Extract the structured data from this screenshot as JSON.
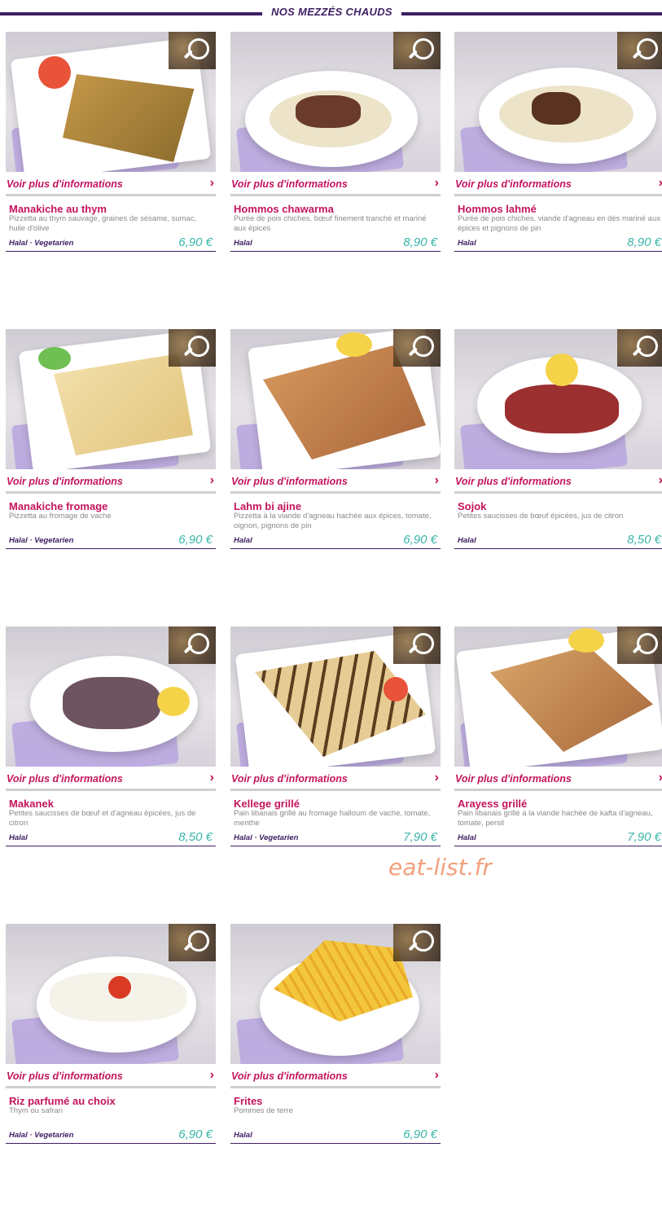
{
  "section_title": "NOS MEZZÉS CHAUDS",
  "more_label": "Voir plus d'informations",
  "watermark": "eat-list.fr",
  "colors": {
    "brand": "#3d1f63",
    "accent": "#c4145c",
    "price": "#39b5a9"
  },
  "items": [
    {
      "name": "Manakiche au thym",
      "desc": "Pizzetta au thym sauvage, graines de sésame, sumac, huile d'olive",
      "tags": "Halal · Vegetarien",
      "price": "6,90 €"
    },
    {
      "name": "Hommos chawarma",
      "desc": "Purée de pois chiches, bœuf finement tranché et mariné aux épices",
      "tags": "Halal",
      "price": "8,90 €"
    },
    {
      "name": "Hommos lahmé",
      "desc": "Purée de pois chiches, viande d'agneau en dés mariné aux épices et pignons de pin",
      "tags": "Halal",
      "price": "8,90 €"
    },
    {
      "name": "Manakiche fromage",
      "desc": "Pizzetta au fromage de vache",
      "tags": "Halal · Vegetarien",
      "price": "6,90 €"
    },
    {
      "name": "Lahm bi ajine",
      "desc": "Pizzetta à la viande d'agneau hachée aux épices, tomate, oignon, pignons de pin",
      "tags": "Halal",
      "price": "6,90 €"
    },
    {
      "name": "Sojok",
      "desc": "Petites saucisses de bœuf épicées, jus de citron",
      "tags": "Halal",
      "price": "8,50 €"
    },
    {
      "name": "Makanek",
      "desc": "Petites saucisses de bœuf et d'agneau épicées, jus de citron",
      "tags": "Halal",
      "price": "8,50 €"
    },
    {
      "name": "Kellege grillé",
      "desc": "Pain libanais grillé au fromage halloum de vache, tomate, menthe",
      "tags": "Halal · Vegetarien",
      "price": "7,90 €"
    },
    {
      "name": "Arayess grillé",
      "desc": "Pain libanais grillé à la viande hachée de kafta d'agneau, tomate, persil",
      "tags": "Halal",
      "price": "7,90 €"
    },
    {
      "name": "Riz parfumé au choix",
      "desc": "Thym ou safran",
      "tags": "Halal · Vegetarien",
      "price": "6,90 €"
    },
    {
      "name": "Frites",
      "desc": "Pommes de terre",
      "tags": "Halal",
      "price": "6,90 €"
    }
  ]
}
